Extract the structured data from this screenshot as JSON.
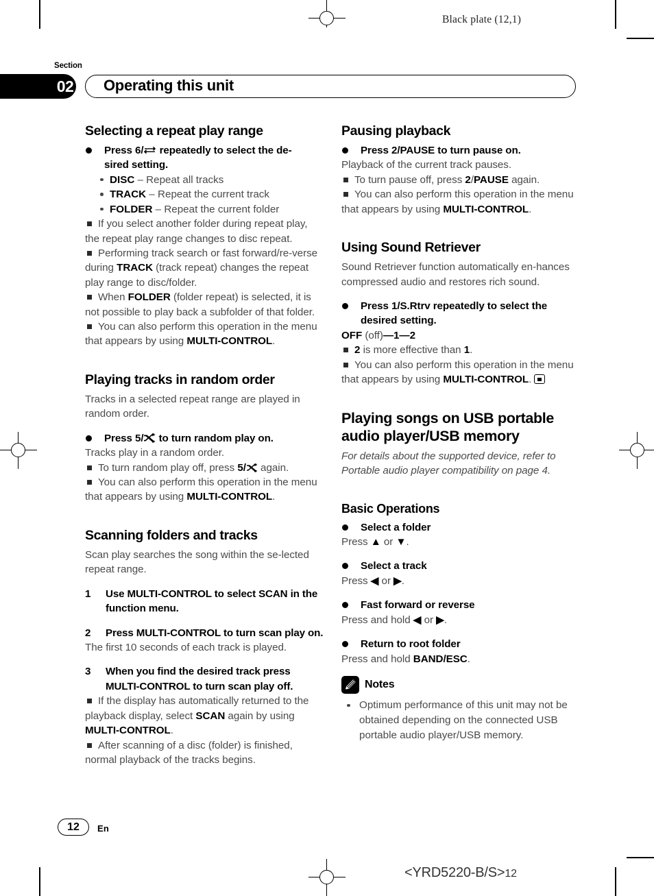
{
  "plate_note": "Black plate (12,1)",
  "header": {
    "section_label": "Section",
    "section_number": "02",
    "title": "Operating this unit"
  },
  "left_column": {
    "repeat": {
      "heading": "Selecting a repeat play range",
      "instruction_a": "Press 6/",
      "instruction_b": " repeatedly to select the de-",
      "instruction_c": "sired setting.",
      "options": [
        {
          "term": "DISC",
          "desc": " – Repeat all tracks"
        },
        {
          "term": "TRACK",
          "desc": " – Repeat the current track"
        },
        {
          "term": "FOLDER",
          "desc": " – Repeat the current folder"
        }
      ],
      "note1": "If you select another folder during repeat play, the repeat play range changes to disc repeat.",
      "note2_a": "Performing track search or fast forward/re-verse during ",
      "note2_b": "TRACK",
      "note2_c": " (track repeat) changes the repeat play range to disc/folder.",
      "note3_a": "When ",
      "note3_b": "FOLDER",
      "note3_c": " (folder repeat) is selected, it is not possible to play back a subfolder of that folder.",
      "note4_a": "You can also perform this operation in the menu that appears by using ",
      "note4_b": "MULTI-CONTROL",
      "note4_c": "."
    },
    "random": {
      "heading": "Playing tracks in random order",
      "intro": "Tracks in a selected repeat range are played in random order.",
      "instruction_a": "Press 5/",
      "instruction_b": " to turn random play on.",
      "result": "Tracks play in a random order.",
      "note1_a": "To turn random play off, press ",
      "note1_b": "5/",
      "note1_c": " again.",
      "note2_a": "You can also perform this operation in the menu that appears by using ",
      "note2_b": "MULTI-CONTROL",
      "note2_c": "."
    },
    "scan": {
      "heading": "Scanning folders and tracks",
      "intro": "Scan play searches the song within the se-lected repeat range.",
      "step1_num": "1",
      "step1_text": "Use MULTI-CONTROL to select SCAN in the function menu.",
      "step2_num": "2",
      "step2_text": "Press MULTI-CONTROL to turn scan play on.",
      "step2_result": "The first 10 seconds of each track is played.",
      "step3_num": "3",
      "step3_text": "When you find the desired track press MULTI-CONTROL to turn scan play off.",
      "note1_a": "If the display has automatically returned to the playback display, select ",
      "note1_b": "SCAN",
      "note1_c": " again by using ",
      "note1_d": "MULTI-CONTROL",
      "note1_e": ".",
      "note2": "After scanning of a disc (folder) is finished, normal playback of the tracks begins."
    }
  },
  "right_column": {
    "pause": {
      "heading": "Pausing playback",
      "instruction": "Press 2/PAUSE to turn pause on.",
      "result": "Playback of the current track pauses.",
      "note1_a": "To turn pause off, press ",
      "note1_b": "2",
      "note1_c": "/",
      "note1_d": "PAUSE",
      "note1_e": " again.",
      "note2_a": "You can also perform this operation in the menu that appears by using ",
      "note2_b": "MULTI-CONTROL",
      "note2_c": "."
    },
    "retriever": {
      "heading": "Using Sound Retriever",
      "intro": "Sound Retriever function automatically en-hances compressed audio and restores rich sound.",
      "instruction_a": "Press 1/S.Rtrv repeatedly to select the",
      "instruction_b": "desired setting.",
      "settings_off": "OFF",
      "settings_off_paren": " (off)",
      "settings_dash1": "—",
      "settings_1": "1",
      "settings_dash2": "—",
      "settings_2": "2",
      "note1_a": "2",
      "note1_b": " is more effective than ",
      "note1_c": "1",
      "note1_d": ".",
      "note2_a": "You can also perform this operation in the menu that appears by using ",
      "note2_b": "MULTI-CONTROL",
      "note2_c": "."
    },
    "usb": {
      "heading": "Playing songs on USB portable audio player/USB memory",
      "intro": "For details about the supported device, refer to Portable audio player compatibility on page 4.",
      "basic_heading": "Basic Operations",
      "ops": [
        {
          "label": "Select a folder",
          "press_pre": "Press ",
          "k1": "▲",
          "mid": " or ",
          "k2": "▼",
          "post": "."
        },
        {
          "label": "Select a track",
          "press_pre": "Press ",
          "k1": "◀",
          "mid": " or ",
          "k2": "▶",
          "post": "."
        },
        {
          "label": "Fast forward or reverse",
          "press_pre": "Press and hold ",
          "k1": "◀",
          "mid": " or ",
          "k2": "▶",
          "post": "."
        },
        {
          "label": "Return to root folder",
          "press_pre": "Press and hold ",
          "k1": "BAND/ESC",
          "mid": "",
          "k2": "",
          "post": "."
        }
      ],
      "notes_title": "Notes",
      "note1": "Optimum performance of this unit may not be obtained depending on the connected USB portable audio player/USB memory."
    }
  },
  "footer": {
    "page_number": "12",
    "language": "En",
    "model_code": "<YRD5220-B/S>",
    "model_code_suffix": "12"
  },
  "icons": {
    "repeat": "repeat-icon",
    "random": "shuffle-icon",
    "notes": "pencil-icon",
    "end_of_section": "end-of-section-icon",
    "registration": "registration-mark-icon"
  }
}
